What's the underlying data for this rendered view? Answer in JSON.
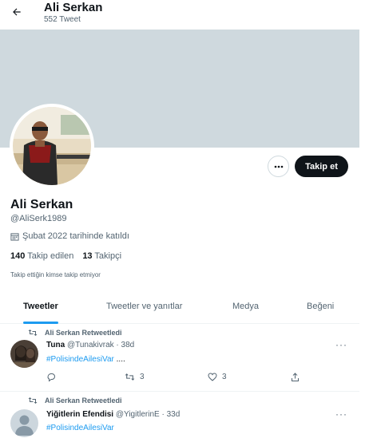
{
  "header": {
    "title": "Ali Serkan",
    "subtitle": "552 Tweet"
  },
  "profile": {
    "name": "Ali Serkan",
    "handle": "@AliSerk1989",
    "joined": "Şubat 2022 tarihinde katıldı",
    "following_count": "140",
    "following_label": "Takip edilen",
    "followers_count": "13",
    "followers_label": "Takipçi",
    "note": "Takip ettiğin kimse takip etmiyor",
    "follow_button": "Takip et"
  },
  "tabs": [
    {
      "label": "Tweetler",
      "active": true
    },
    {
      "label": "Tweetler ve yanıtlar",
      "active": false
    },
    {
      "label": "Medya",
      "active": false
    },
    {
      "label": "Beğeni",
      "active": false
    }
  ],
  "tweets": [
    {
      "retweet_text": "Ali Serkan Retweetledi",
      "author": "Tuna",
      "handle": "@Tunakivrak",
      "time": "· 38d",
      "hashtag": "#PolisindeAilesiVar",
      "trail": " ....",
      "retweets": "3",
      "likes": "3"
    },
    {
      "retweet_text": "Ali Serkan Retweetledi",
      "author": "Yiğitlerin Efendisi",
      "handle": "@YigitlerinE",
      "time": "· 33d",
      "hashtag": "#PolisindeAilesiVar"
    }
  ],
  "colors": {
    "accent": "#1d9bf0",
    "banner": "#cfd9de",
    "text": "#0f1419",
    "muted": "#536471"
  }
}
